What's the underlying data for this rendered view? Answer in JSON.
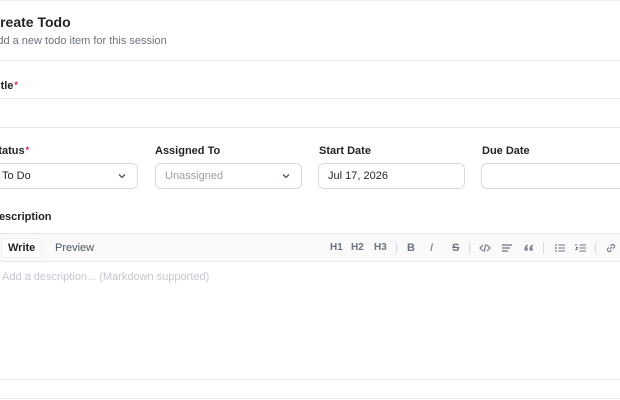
{
  "dialog": {
    "title": "Create Todo",
    "subtitle": "Add a new todo item for this session"
  },
  "form": {
    "title_label": "Title",
    "title_value": "",
    "status_label": "Status",
    "status_value": "To Do",
    "assigned_label": "Assigned To",
    "assigned_placeholder": "Unassigned",
    "start_date_label": "Start Date",
    "start_date_value": "Jul 17, 2026",
    "due_date_label": "Due Date",
    "due_date_value": "",
    "description_label": "Description",
    "description_placeholder": "Add a description... (Markdown supported)"
  },
  "editor": {
    "tabs": [
      "Write",
      "Preview"
    ],
    "active_tab": "Write",
    "toolbar": {
      "h1": "H1",
      "h2": "H2",
      "h3": "H3",
      "bold": "B",
      "italic": "I",
      "strike": "S"
    },
    "icons": [
      "heading-1-icon",
      "heading-2-icon",
      "heading-3-icon",
      "bold-icon",
      "italic-icon",
      "strikethrough-icon",
      "code-icon",
      "paragraph-icon",
      "quote-icon",
      "bullet-list-icon",
      "numbered-list-icon",
      "link-icon"
    ]
  },
  "colors": {
    "required_marker": "#e11d48",
    "border": "#d9dde3",
    "muted_text": "#6b7280"
  }
}
